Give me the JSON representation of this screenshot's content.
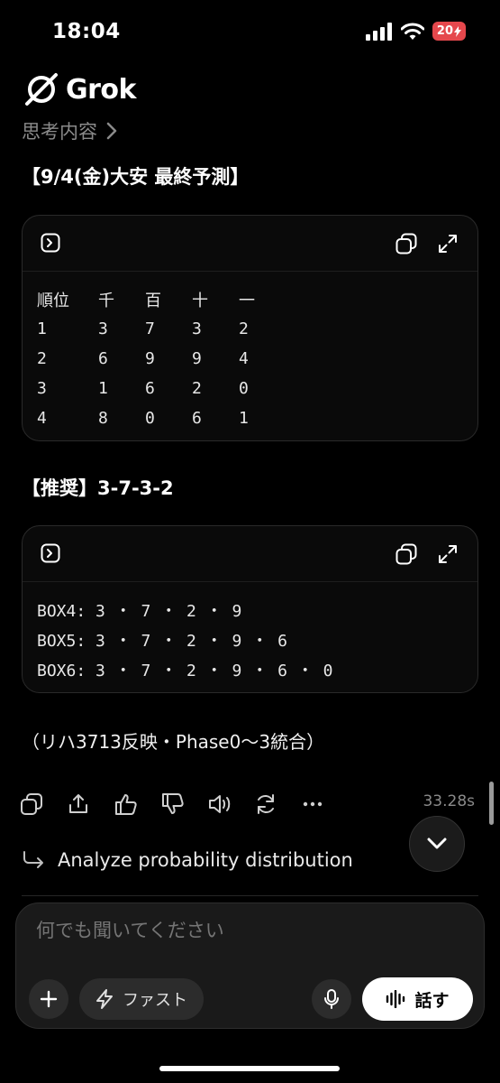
{
  "status": {
    "time": "18:04",
    "battery": "20"
  },
  "header": {
    "brand": "Grok",
    "thinking_label": "思考内容"
  },
  "response": {
    "heading": "【9/4(金)大安 最終予測】",
    "table": {
      "headers": [
        "順位",
        "千",
        "百",
        "十",
        "一"
      ],
      "rows": [
        [
          "1",
          "3",
          "7",
          "3",
          "2"
        ],
        [
          "2",
          "6",
          "9",
          "9",
          "4"
        ],
        [
          "3",
          "1",
          "6",
          "2",
          "0"
        ],
        [
          "4",
          "8",
          "0",
          "6",
          "1"
        ]
      ]
    },
    "recommend": "【推奨】3-7-3-2",
    "box_lines": [
      "BOX4: 3 ・ 7 ・ 2 ・ 9",
      "BOX5: 3 ・ 7 ・ 2 ・ 9 ・ 6",
      "BOX6: 3 ・ 7 ・ 2 ・ 9 ・ 6 ・ 0"
    ],
    "note": "（リハ3713反映・Phase0〜3統合）"
  },
  "actions": {
    "elapsed": "33.28s"
  },
  "followup": "Analyze probability distribution",
  "composer": {
    "placeholder": "何でも聞いてください",
    "mode_label": "ファスト",
    "talk_label": "話す"
  }
}
